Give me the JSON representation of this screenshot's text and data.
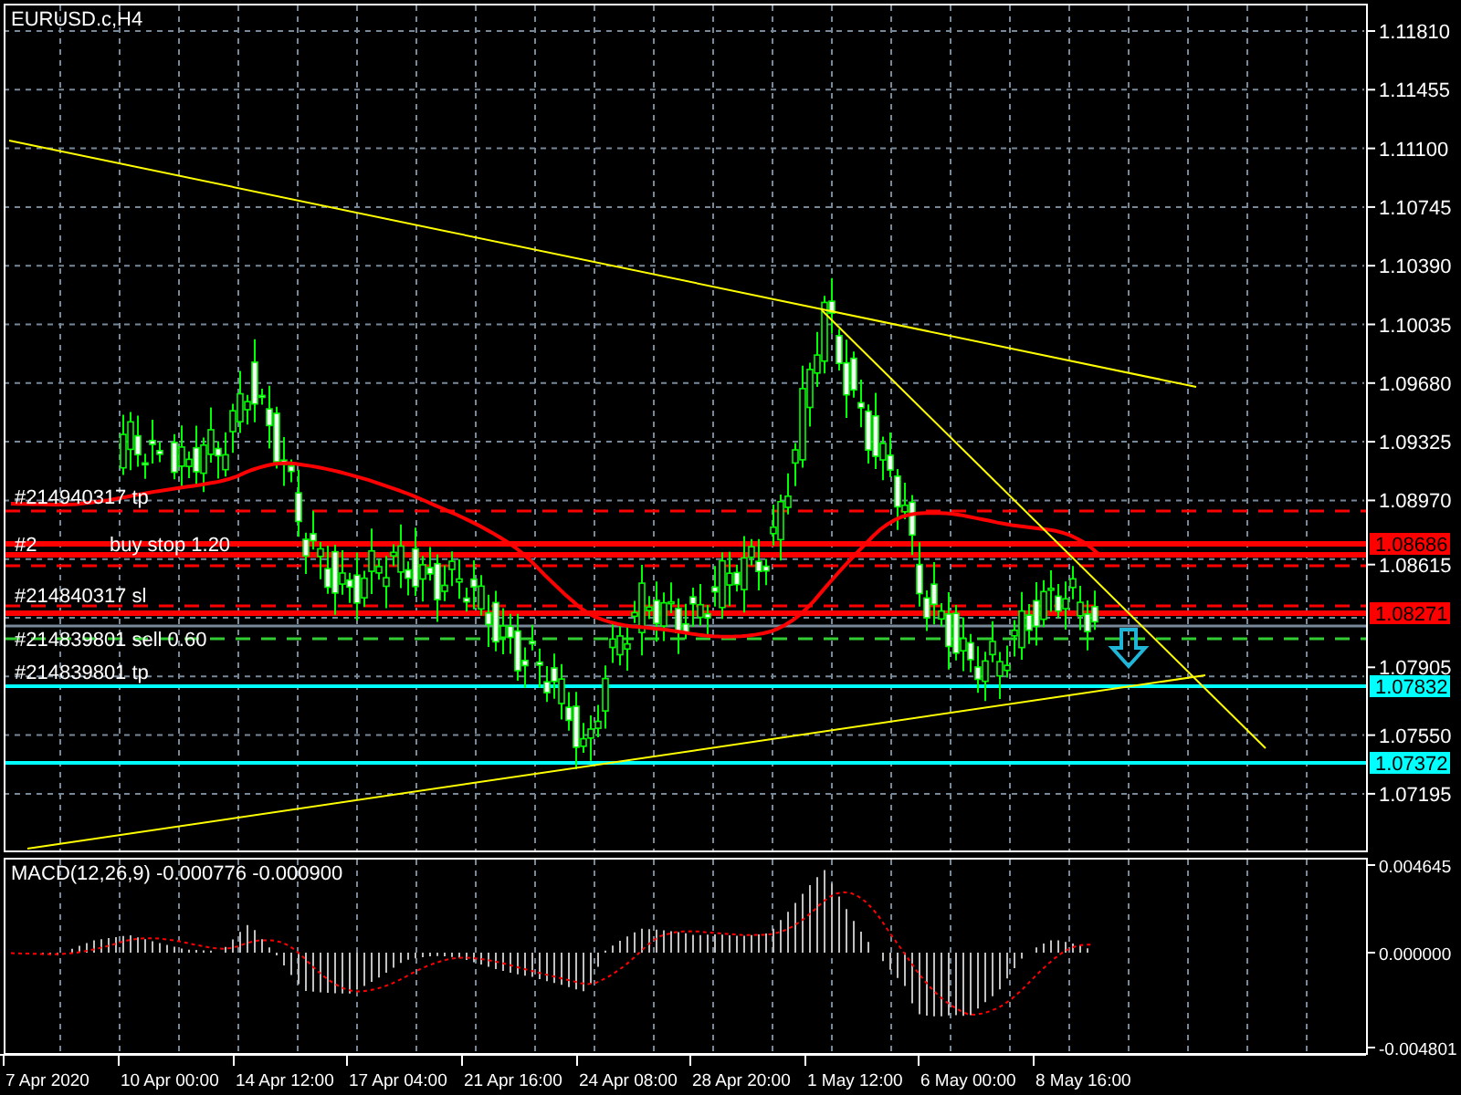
{
  "chart": {
    "title": "EURUSD.c,H4",
    "price_axis": [
      "1.11810",
      "1.11455",
      "1.11100",
      "1.10745",
      "1.10390",
      "1.10035",
      "1.09680",
      "1.09325",
      "1.08970",
      "1.08615",
      "1.07905",
      "1.07550",
      "1.07195"
    ],
    "order_lines": [
      {
        "kind": "tp_dashed",
        "label": "#214940317 tp"
      },
      {
        "kind": "pending",
        "label": "buy stop 1.20",
        "prefix": "#2"
      },
      {
        "kind": "sl_dashed",
        "label": "#214840317 sl"
      },
      {
        "kind": "entry",
        "label": "#214839801 sell 0.60"
      },
      {
        "kind": "tp",
        "label": "#214839801 tp"
      }
    ],
    "price_tags": [
      {
        "price": "1.08686",
        "color": "#ff0000"
      },
      {
        "price": "1.08271",
        "color": "#ff0000"
      },
      {
        "price": "1.07832",
        "color": "#00ffff"
      },
      {
        "price": "1.07372",
        "color": "#00ffff"
      }
    ],
    "time_axis": [
      "7 Apr 2020",
      "10 Apr 00:00",
      "14 Apr 12:00",
      "17 Apr 04:00",
      "21 Apr 16:00",
      "24 Apr 08:00",
      "28 Apr 20:00",
      "1 May 12:00",
      "6 May 00:00",
      "8 May 16:00"
    ]
  },
  "macd": {
    "label": "MACD(12,26,9) -0.000776 -0.000900",
    "axis": [
      "0.004645",
      "0.000000",
      "-0.004801"
    ]
  }
}
